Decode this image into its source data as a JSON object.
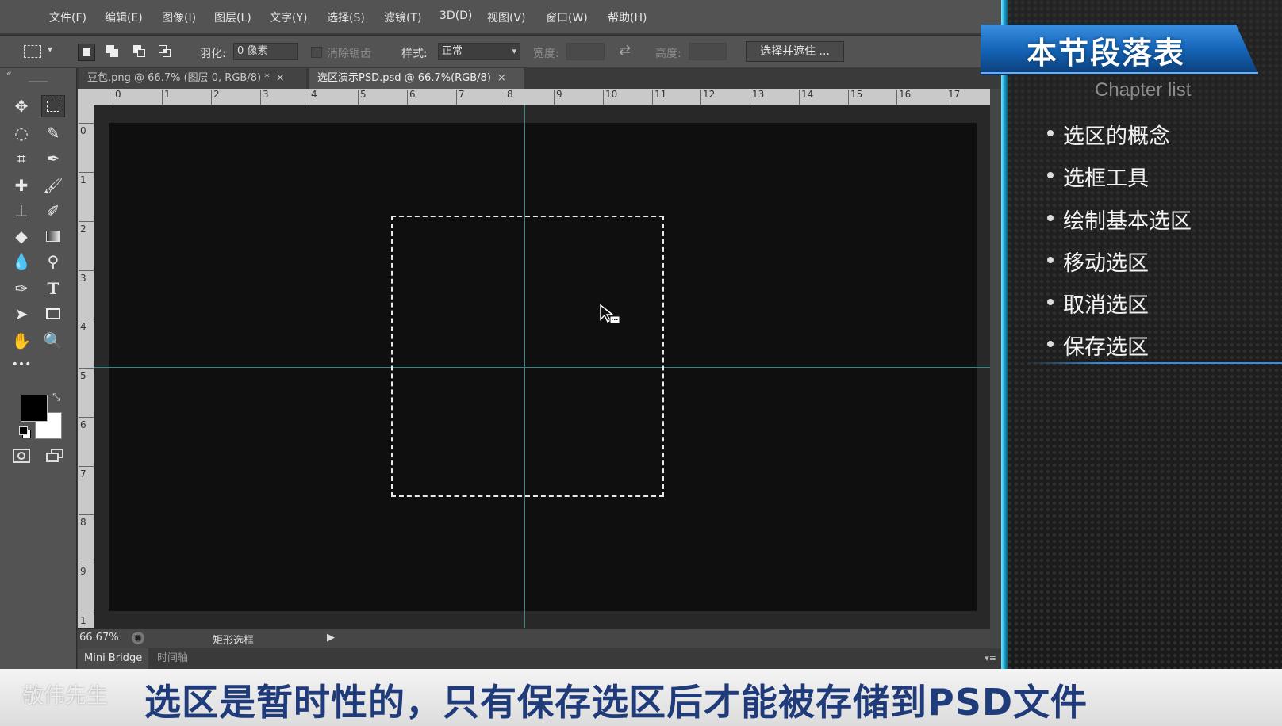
{
  "menubar": {
    "items": [
      "文件(F)",
      "编辑(E)",
      "图像(I)",
      "图层(L)",
      "文字(Y)",
      "选择(S)",
      "滤镜(T)",
      "3D(D)",
      "视图(V)",
      "窗口(W)",
      "帮助(H)"
    ]
  },
  "options": {
    "feather_label": "羽化:",
    "feather_value": "0 像素",
    "antialias_label": "消除锯齿",
    "style_label": "样式:",
    "style_value": "正常",
    "width_label": "宽度:",
    "height_label": "高度:",
    "select_mask_button": "选择并遮住 ..."
  },
  "tabs": [
    {
      "label": "豆包.png @ 66.7% (图层 0, RGB/8) *",
      "close": "×"
    },
    {
      "label": "选区演示PSD.psd @ 66.7%(RGB/8)",
      "close": "×"
    }
  ],
  "ruler": {
    "top": [
      "0",
      "1",
      "2",
      "3",
      "4",
      "5",
      "6",
      "7",
      "8",
      "9",
      "10",
      "11",
      "12",
      "13",
      "14",
      "15",
      "16",
      "17"
    ],
    "left": [
      "0",
      "1",
      "2",
      "3",
      "4",
      "5",
      "6",
      "7",
      "8",
      "9",
      "1"
    ]
  },
  "toolbar": {
    "more": "•••",
    "type_tool": "T"
  },
  "status": {
    "zoom": "66.67%",
    "tool_name": "矩形选框"
  },
  "bottom_tabs": {
    "mini_bridge": "Mini Bridge",
    "timeline": "时间轴"
  },
  "chapter": {
    "title": "本节段落表",
    "subtitle": "Chapter list",
    "items": [
      "选区的概念",
      "选框工具",
      "绘制基本选区",
      "移动选区",
      "取消选区",
      "保存选区"
    ]
  },
  "caption": {
    "text": "选区是暂时性的，只有保存选区后才能被存储到PSD文件",
    "watermark": "敬伟先生"
  },
  "colors": {
    "accent_glow": "#19a7d6",
    "guide": "#2f8a8a",
    "caption_text": "#1f3b7a",
    "banner_blue": "#1565b8"
  }
}
